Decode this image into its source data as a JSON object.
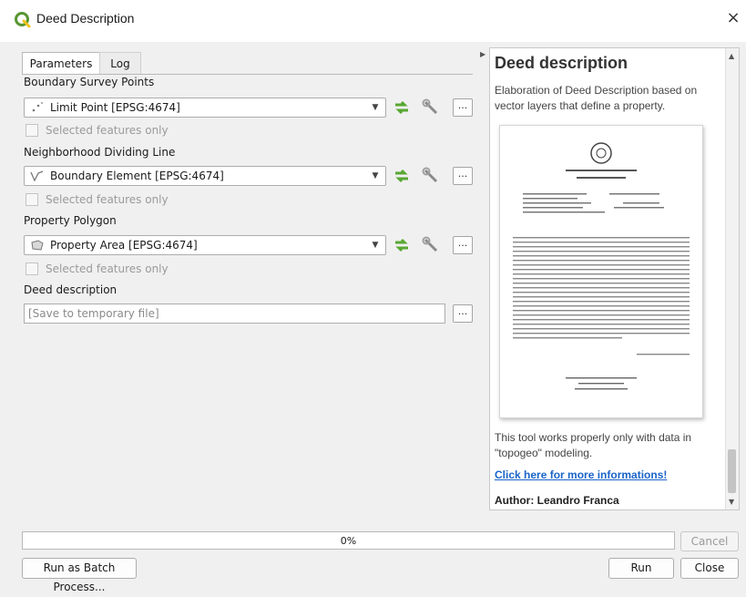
{
  "window": {
    "title": "Deed Description",
    "close_label": "×"
  },
  "tabs": [
    {
      "label": "Parameters"
    },
    {
      "label": "Log"
    }
  ],
  "params": {
    "boundary_points": {
      "label": "Boundary Survey Points",
      "value": "Limit Point [EPSG:4674]",
      "selected_only": "Selected features only"
    },
    "dividing_line": {
      "label": "Neighborhood Dividing Line",
      "value": "Boundary Element [EPSG:4674]",
      "selected_only": "Selected features only"
    },
    "polygon": {
      "label": "Property Polygon",
      "value": "Property Area [EPSG:4674]",
      "selected_only": "Selected features only"
    },
    "deed": {
      "label": "Deed description",
      "placeholder": "[Save to temporary file]"
    },
    "ellipsis": "..."
  },
  "help": {
    "title": "Deed description",
    "description": "Elaboration of Deed Description based on vector layers that define a property.",
    "note": "This tool works properly only with data in \"topogeo\" modeling.",
    "link": "Click here for more informations!",
    "author": "Author: Leandro Franca"
  },
  "progress": {
    "value": 0,
    "label": "0%"
  },
  "buttons": {
    "cancel": "Cancel",
    "batch": "Run as Batch Process...",
    "run": "Run",
    "close": "Close"
  },
  "colors": {
    "accent_green": "#58a832",
    "link": "#1a64c8",
    "progress_fill": "#3c8dde"
  }
}
